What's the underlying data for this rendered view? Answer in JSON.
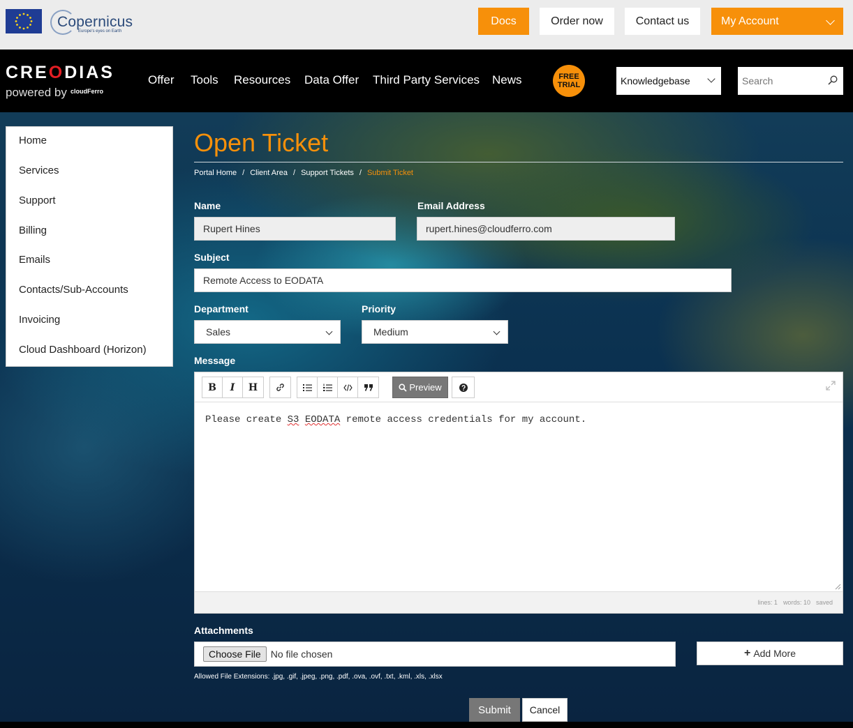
{
  "topbar": {
    "copernicus_word": "Copernicus",
    "copernicus_tagline": "Europe's eyes on Earth",
    "docs_label": "Docs",
    "order_label": "Order now",
    "contact_label": "Contact us",
    "account_label": "My Account"
  },
  "nav": {
    "logo_pre": "CRE",
    "logo_o": "O",
    "logo_post": "DIAS",
    "powered": "powered by",
    "cloudferro": "cloudFerro",
    "items": [
      "Offer",
      "Tools",
      "Resources",
      "Data Offer",
      "Third Party Services",
      "News"
    ],
    "free_trial_line1": "FREE",
    "free_trial_line2": "TRIAL",
    "kb_select": "Knowledgebase",
    "search_placeholder": "Search"
  },
  "sidebar": {
    "items": [
      "Home",
      "Services",
      "Support",
      "Billing",
      "Emails",
      "Contacts/Sub-Accounts",
      "Invoicing",
      "Cloud Dashboard (Horizon)"
    ]
  },
  "page": {
    "title": "Open Ticket",
    "breadcrumb": [
      "Portal Home",
      "Client Area",
      "Support Tickets",
      "Submit Ticket"
    ],
    "breadcrumb_sep": "/"
  },
  "form": {
    "name_label": "Name",
    "name_value": "Rupert Hines",
    "email_label": "Email Address",
    "email_value": "rupert.hines@cloudferro.com",
    "subject_label": "Subject",
    "subject_value": "Remote Access to EODATA",
    "department_label": "Department",
    "department_value": "Sales",
    "priority_label": "Priority",
    "priority_value": "Medium",
    "message_label": "Message",
    "message_pre": "Please create ",
    "message_s3": "S3",
    "message_mid": " ",
    "message_eodata": "EODATA",
    "message_post": " remote access credentials for my account.",
    "toolbar": {
      "bold": "B",
      "italic": "I",
      "heading": "H",
      "preview": "Preview"
    },
    "status": {
      "lines": "lines: 1",
      "words": "words: 10",
      "saved": "saved"
    },
    "attachments_label": "Attachments",
    "choose_file": "Choose File",
    "no_file": "No file chosen",
    "add_more": "Add More",
    "allowed": "Allowed File Extensions: .jpg, .gif, .jpeg, .png, .pdf, .ova, .ovf, .txt, .kml, .xls, .xlsx",
    "submit": "Submit",
    "cancel": "Cancel"
  },
  "colors": {
    "accent": "#f7900a",
    "eu_blue": "#1f3c94",
    "logo_red": "#e31e24"
  }
}
